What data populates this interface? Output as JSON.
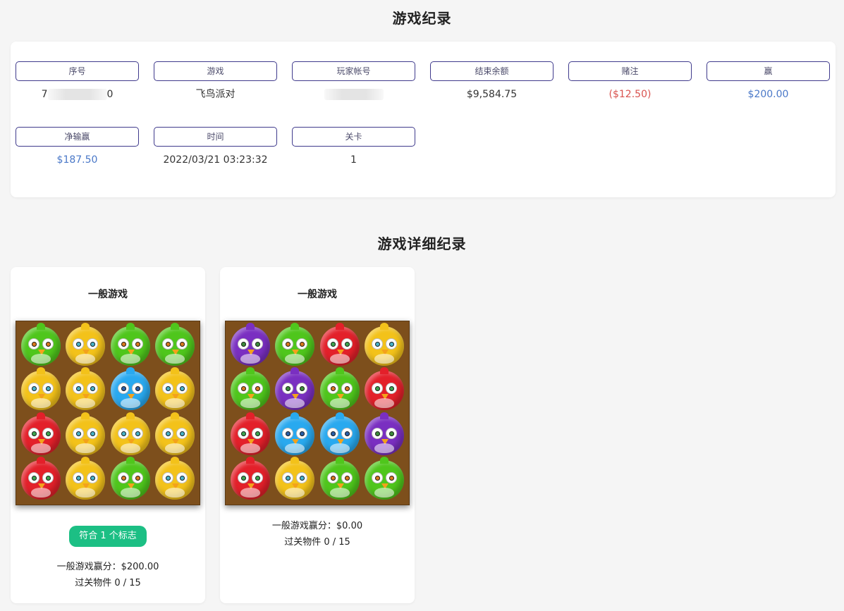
{
  "page_title": "游戏纪录",
  "summary": {
    "fields": [
      {
        "label": "序号",
        "value_prefix": "7",
        "value_suffix": "0"
      },
      {
        "label": "游戏",
        "value": "飞鸟派对"
      },
      {
        "label": "玩家帐号",
        "value": ""
      },
      {
        "label": "结束余额",
        "value": "$9,584.75"
      },
      {
        "label": "赌注",
        "value": "($12.50)"
      },
      {
        "label": "赢",
        "value": "$200.00"
      },
      {
        "label": "净输赢",
        "value": "$187.50"
      },
      {
        "label": "时间",
        "value": "2022/03/21 03:23:32"
      },
      {
        "label": "关卡",
        "value": "1"
      }
    ]
  },
  "details_title": "游戏详细纪录",
  "spins": [
    {
      "title": "一般游戏",
      "board": [
        [
          "green",
          "yellow",
          "green",
          "green"
        ],
        [
          "yellow",
          "yellow",
          "blue",
          "yellow"
        ],
        [
          "red",
          "yellow",
          "yellow",
          "yellow"
        ],
        [
          "red",
          "yellow",
          "green",
          "yellow"
        ]
      ],
      "badge": "符合 1 个标志",
      "win_line": "一般游戏赢分：$200.00",
      "objects_line": "过关物件 0 / 15"
    },
    {
      "title": "一般游戏",
      "board": [
        [
          "purple",
          "green",
          "red",
          "yellow"
        ],
        [
          "green",
          "purple",
          "green",
          "red"
        ],
        [
          "red",
          "blue",
          "blue",
          "purple"
        ],
        [
          "red",
          "yellow",
          "green",
          "green"
        ]
      ],
      "win_line": "一般游戏赢分：$0.00",
      "objects_line": "过关物件 0 / 15"
    }
  ],
  "colors": {
    "label_border": "#3f3a8c",
    "negative": "#d9534f",
    "positive": "#4a78c8",
    "badge": "#1cbf84",
    "board_bg": "#7d4f1c"
  }
}
